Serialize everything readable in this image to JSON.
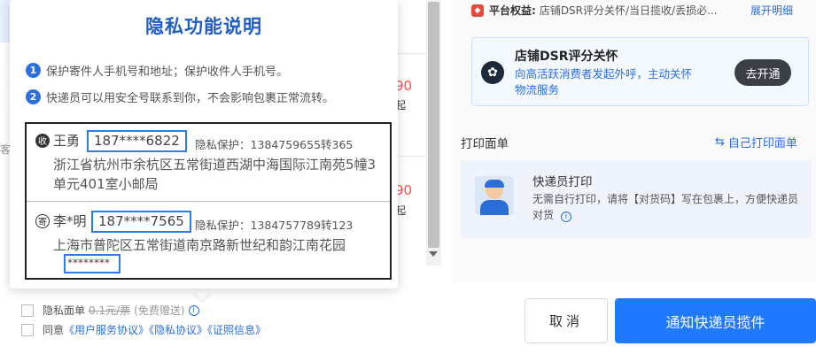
{
  "left_bg": {
    "prices": [
      "90",
      "90"
    ],
    "units": [
      "起",
      "起"
    ],
    "side_char": "客"
  },
  "popup": {
    "title": "隐私功能说明",
    "tips": [
      {
        "num": "1",
        "text": "保护寄件人手机号和地址；保护收件人手机号。"
      },
      {
        "num": "2",
        "text": "快递员可以用安全号联系到你，不会影响包裹正常流转。"
      }
    ],
    "sender": {
      "badge": "收",
      "name": "王勇",
      "phone": "187****6822",
      "protect": "隐私保护：1384759655转365",
      "address": "浙江省杭州市余杭区五常街道西湖中海国际江南苑5幢3单元401室小邮局"
    },
    "receiver": {
      "badge": "寄",
      "name": "李*明",
      "phone": "187****7565",
      "protect": "隐私保护：1384757789转123",
      "address": "上海市普陀区五常街道南京路新世纪和韵江南花园",
      "masked": "********"
    }
  },
  "checks": {
    "privacy_label": "隐私面单",
    "privacy_price": "0.1元/票",
    "privacy_free": "(免费赠送)",
    "agree_prefix": "同意",
    "agree_links": "《用户服务协议》《隐私协议》《证照信息》"
  },
  "right": {
    "benefit_label": "平台权益:",
    "benefit_text": "店铺DSR评分关怀/当日揽收/丢损必...",
    "benefit_link": "展开明细",
    "dsr_title": "店铺DSR评分关怀",
    "dsr_desc": "向高活跃消费者发起外呼，主动关怀物流服务",
    "dsr_btn": "去开通",
    "print_title": "打印面单",
    "print_self": "自己打印面单",
    "courier_title": "快递员打印",
    "courier_desc": "无需自行打印，请将【对货码】写在包裹上，方便快递员对货"
  },
  "buttons": {
    "cancel": "取消",
    "notify": "通知快递员揽件"
  }
}
